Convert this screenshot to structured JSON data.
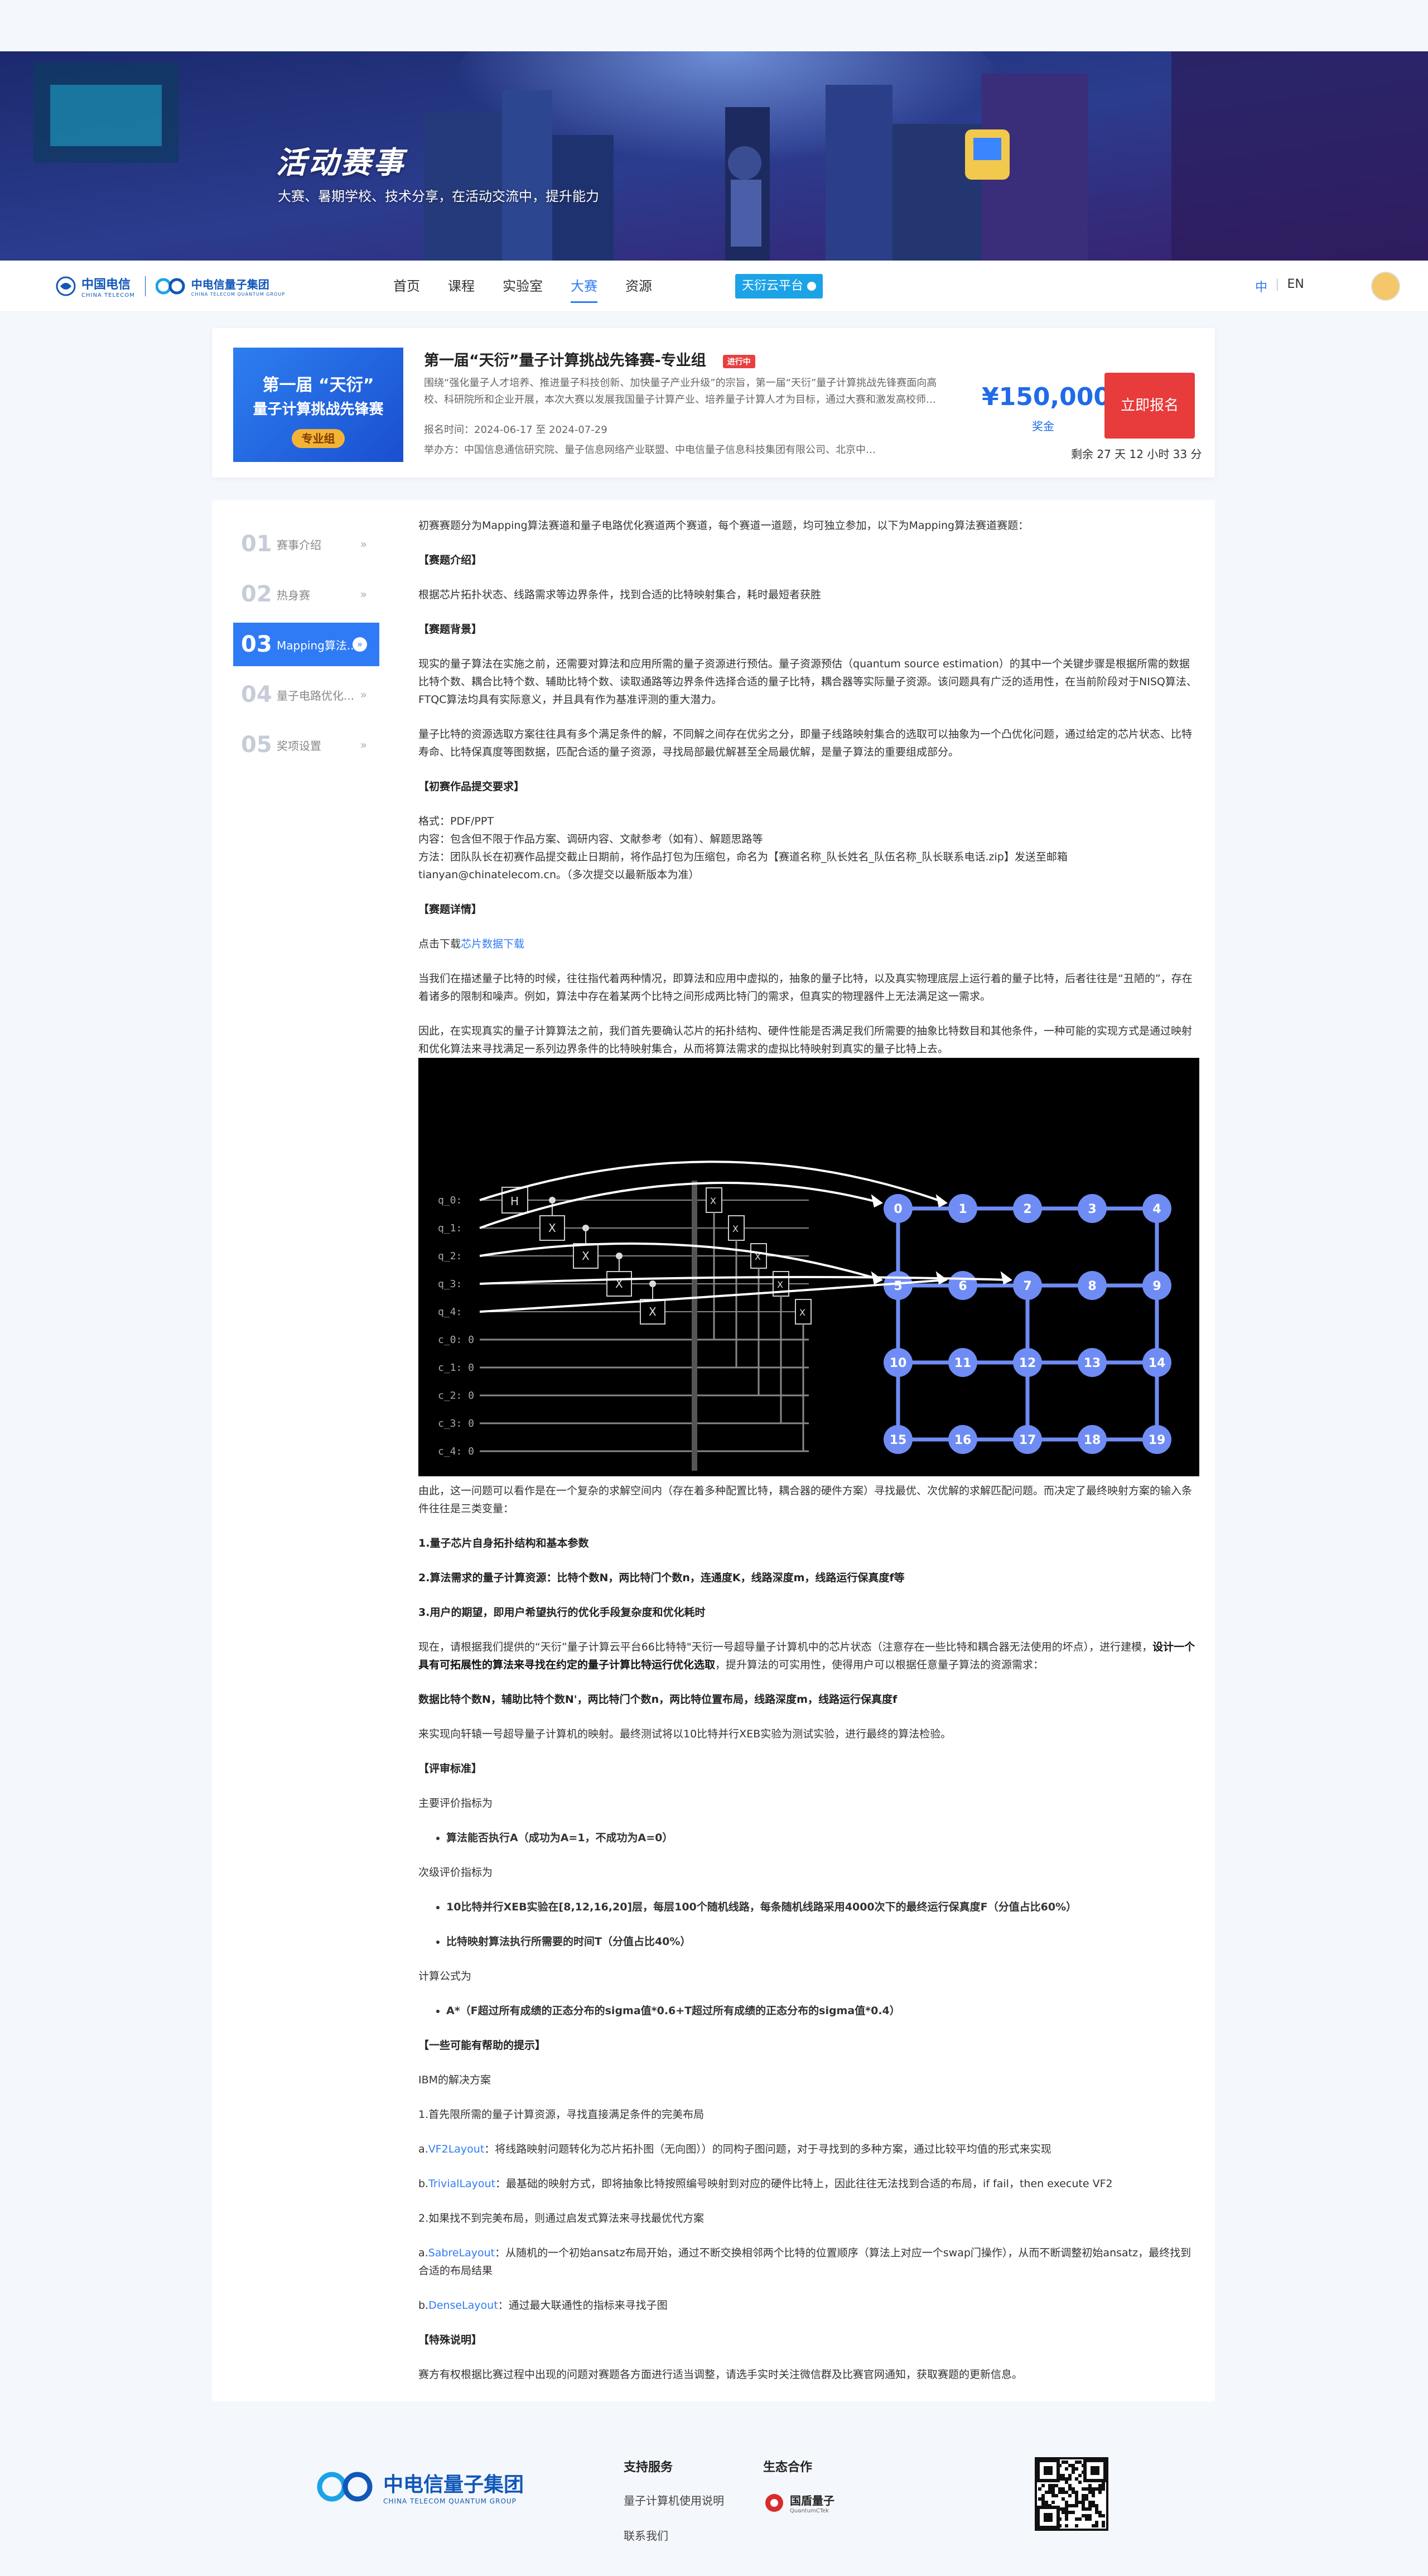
{
  "hero": {
    "title": "活动赛事",
    "subtitle": "大赛、暑期学校、技术分享，在活动交流中，提升能力"
  },
  "nav": {
    "logo_main": "中国电信",
    "logo_main_sub": "CHINA TELECOM",
    "logo_group": "中电信量子集团",
    "logo_group_sub": "CHINA TELECOM QUANTUM GROUP",
    "items": [
      "首页",
      "课程",
      "实验室",
      "大赛",
      "资源"
    ],
    "cloud_btn": "天衍云平台",
    "lang_zh": "中",
    "lang_en": "EN"
  },
  "contest": {
    "thumb_line1": "第一届 “天衍”",
    "thumb_line2": "量子计算挑战先锋赛",
    "thumb_tag": "专业组",
    "title": "第一届“天衍”量子计算挑战先锋赛-专业组",
    "status": "进行中",
    "desc": "围绕“强化量子人才培养、推进量子科技创新、加快量子产业升级”的宗旨，第一届“天衍”量子计算挑战先锋赛面向高校、科研院所和企业开展，本次大赛以发展我国量子计算产业、培养量子计算人才为目标，通过大赛和激发高校师…",
    "date": "报名时间：2024-06-17 至 2024-07-29",
    "org": "举办方：中国信息通信研究院、量子信息网络产业联盟、中电信量子信息科技集团有限公司、北京中…",
    "prize": "¥150,000",
    "prize_label": "奖金",
    "signup": "立即报名",
    "remain": "剩余 27 天 12 小时 33 分"
  },
  "sidebar": {
    "items": [
      {
        "num": "01",
        "label": "赛事介绍",
        "arrow": "»"
      },
      {
        "num": "02",
        "label": "热身赛",
        "arrow": "»"
      },
      {
        "num": "03",
        "label": "Mapping算法...",
        "arrow": "»"
      },
      {
        "num": "04",
        "label": "量子电路优化...",
        "arrow": "»"
      },
      {
        "num": "05",
        "label": "奖项设置",
        "arrow": "»"
      }
    ]
  },
  "content": {
    "intro": "初赛赛题分为Mapping算法赛道和量子电路优化赛道两个赛道，每个赛道一道题，均可独立参加，以下为Mapping算法赛道赛题：",
    "h_intro": "【赛题介绍】",
    "p_intro": "根据芯片拓扑状态、线路需求等边界条件，找到合适的比特映射集合，耗时最短者获胜",
    "h_bg": "【赛题背景】",
    "p_bg1": "现实的量子算法在实施之前，还需要对算法和应用所需的量子资源进行预估。量子资源预估（quantum source estimation）的其中一个关键步骤是根据所需的数据比特个数、耦合比特个数、辅助比特个数、读取通路等边界条件选择合适的量子比特，耦合器等实际量子资源。该问题具有广泛的适用性，在当前阶段对于NISQ算法、FTQC算法均具有实际意义，并且具有作为基准评测的重大潜力。",
    "p_bg2": "量子比特的资源选取方案往往具有多个满足条件的解，不同解之间存在优劣之分，即量子线路映射集合的选取可以抽象为一个凸优化问题，通过给定的芯片状态、比特寿命、比特保真度等图数据，匹配合适的量子资源，寻找局部最优解甚至全局最优解，是量子算法的重要组成部分。",
    "h_submit": "【初赛作品提交要求】",
    "p_submit1": "格式：PDF/PPT",
    "p_submit2": "内容：包含但不限于作品方案、调研内容、文献参考（如有）、解题思路等",
    "p_submit3": "方法：团队队长在初赛作品提交截止日期前，将作品打包为压缩包，命名为【赛道名称_队长姓名_队伍名称_队长联系电话.zip】发送至邮箱tianyan@chinatelecom.cn。（多次提交以最新版本为准）",
    "h_detail": "【赛题详情】",
    "download_prefix": "点击下载",
    "download_link": "芯片数据下载",
    "p_detail1": "当我们在描述量子比特的时候，往往指代着两种情况，即算法和应用中虚拟的，抽象的量子比特，以及真实物理底层上运行着的量子比特，后者往往是“丑陋的”，存在着诸多的限制和噪声。例如，算法中存在着某两个比特之间形成两比特门的需求，但真实的物理器件上无法满足这一需求。",
    "p_detail2": "因此，在实现真实的量子计算算法之前，我们首先要确认芯片的拓扑结构、硬件性能是否满足我们所需要的抽象比特数目和其他条件，一种可能的实现方式是通过映射和优化算法来寻找满足一系列边界条件的比特映射集合，从而将算法需求的虚拟比特映射到真实的量子比特上去。",
    "p_detail3": "由此，这一问题可以看作是在一个复杂的求解空间内（存在着多种配置比特，耦合器的硬件方案）寻找最优、次优解的求解匹配问题。而决定了最终映射方案的输入条件往往是三类变量：",
    "b1": "1.量子芯片自身拓扑结构和基本参数",
    "b2": "2.算法需求的量子计算资源：比特个数N，两比特门个数n，连通度K，线路深度m，线路运行保真度f等",
    "b3": "3.用户的期望，即用户希望执行的优化手段复杂度和优化耗时",
    "p_detail4a": "现在，请根据我们提供的“天衍”量子计算云平台66比特特\"天衍一号超导量子计算机中的芯片状态（注意存在一些比特和耦合器无法使用的坏点），进行建模，",
    "p_detail4b": "设计一个具有可拓展性的算法来寻找在约定的量子计算比特运行优化选取",
    "p_detail4c": "，提升算法的可实用性，使得用户可以根据任意量子算法的资源需求：",
    "b4": "数据比特个数N，辅助比特个数N'，两比特门个数n，两比特位置布局，线路深度m，线路运行保真度f",
    "p_detail5": "来实现向轩辕一号超导量子计算机的映射。最终测试将以10比特并行XEB实验为测试实验，进行最终的算法检验。",
    "h_eval": "【评审标准】",
    "p_eval1": "主要评价指标为",
    "li1": "算法能否执行A（成功为A=1，不成功为A=0）",
    "p_eval2": "次级评价指标为",
    "li2": "10比特并行XEB实验在[8,12,16,20]层，每层100个随机线路，每条随机线路采用4000次下的最终运行保真度F（分值占比60%）",
    "li3": "比特映射算法执行所需要的时间T（分值占比40%）",
    "p_eval3": "计算公式为",
    "li4": "A*（F超过所有成绩的正态分布的sigma值*0.6+T超过所有成绩的正态分布的sigma值*0.4）",
    "h_hint": "【一些可能有帮助的提示】",
    "p_hint1": "IBM的解决方案",
    "p_hint2": "1.首先限所需的量子计算资源，寻找直接满足条件的完美布局",
    "hint_a_prefix": "a.",
    "hint_a_link": "VF2Layout",
    "hint_a_text": "：将线路映射问题转化为芯片拓扑图（无向图））的同构子图问题，对于寻找到的多种方案，通过比较平均值的形式来实现",
    "hint_b_prefix": "b.",
    "hint_b_link": "TrivialLayout",
    "hint_b_text": "：最基础的映射方式，即将抽象比特按照编号映射到对应的硬件比特上，因此往往无法找到合适的布局，if fail，then execute VF2",
    "p_hint3": "2.如果找不到完美布局，则通过启发式算法来寻找最优代方案",
    "hint_c_prefix": "a.",
    "hint_c_link": "SabreLayout",
    "hint_c_text": "：从随机的一个初始ansatz布局开始，通过不断交换相邻两个比特的位置顺序（算法上对应一个swap门操作），从而不断调整初始ansatz，最终找到合适的布局结果",
    "hint_d_prefix": "b.",
    "hint_d_link": "DenseLayout",
    "hint_d_text": "：通过最大联通性的指标来寻找子图",
    "h_special": "【特殊说明】",
    "p_special": "赛方有权根据比赛过程中出现的问题对赛题各方面进行适当调整，请选手实时关注微信群及比赛官网通知，获取赛题的更新信息。"
  },
  "diagram": {
    "qlabels": [
      "q_0:",
      "q_1:",
      "q_2:",
      "q_3:",
      "q_4:",
      "c_0: 0",
      "c_1: 0",
      "c_2: 0",
      "c_3: 0",
      "c_4: 0"
    ],
    "nodes": [
      "0",
      "1",
      "2",
      "3",
      "4",
      "5",
      "6",
      "7",
      "8",
      "9",
      "10",
      "11",
      "12",
      "13",
      "14",
      "15",
      "16",
      "17",
      "18",
      "19"
    ],
    "gate_h": "H",
    "gate_x": "X"
  },
  "footer": {
    "logo": "中电信量子集团",
    "logo_sub": "CHINA TELECOM QUANTUM GROUP",
    "support_title": "支持服务",
    "support_links": [
      "量子计算机使用说明",
      "联系我们"
    ],
    "eco_title": "生态合作",
    "eco_partner": "国盾量子",
    "eco_partner_sub": "QuantumCTek"
  }
}
